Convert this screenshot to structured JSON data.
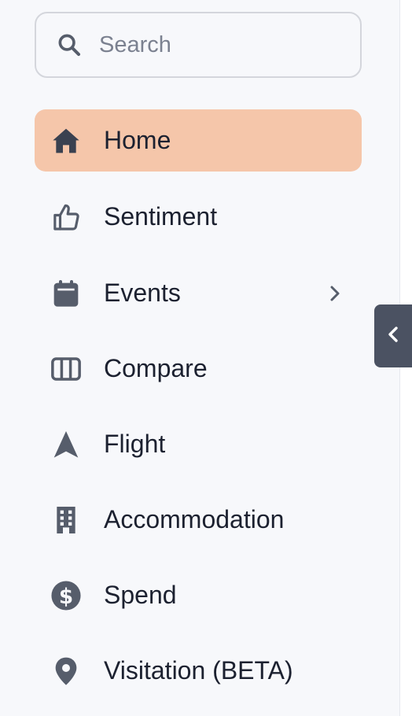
{
  "search": {
    "placeholder": "Search",
    "icon": "search-icon"
  },
  "nav": {
    "items": [
      {
        "label": "Home",
        "icon": "home-icon",
        "active": true
      },
      {
        "label": "Sentiment",
        "icon": "thumbs-up-icon"
      },
      {
        "label": "Events",
        "icon": "calendar-icon",
        "has_children": true
      },
      {
        "label": "Compare",
        "icon": "columns-icon"
      },
      {
        "label": "Flight",
        "icon": "navigation-arrow-icon"
      },
      {
        "label": "Accommodation",
        "icon": "building-icon"
      },
      {
        "label": "Spend",
        "icon": "dollar-circle-icon"
      },
      {
        "label": "Visitation (BETA)",
        "icon": "map-pin-icon"
      }
    ]
  },
  "colors": {
    "active_bg": "#f5c6aa",
    "icon": "#565d6b",
    "text": "#1c2130",
    "sidebar_bg": "#f7f8fb",
    "collapse_btn": "#4b5262"
  }
}
